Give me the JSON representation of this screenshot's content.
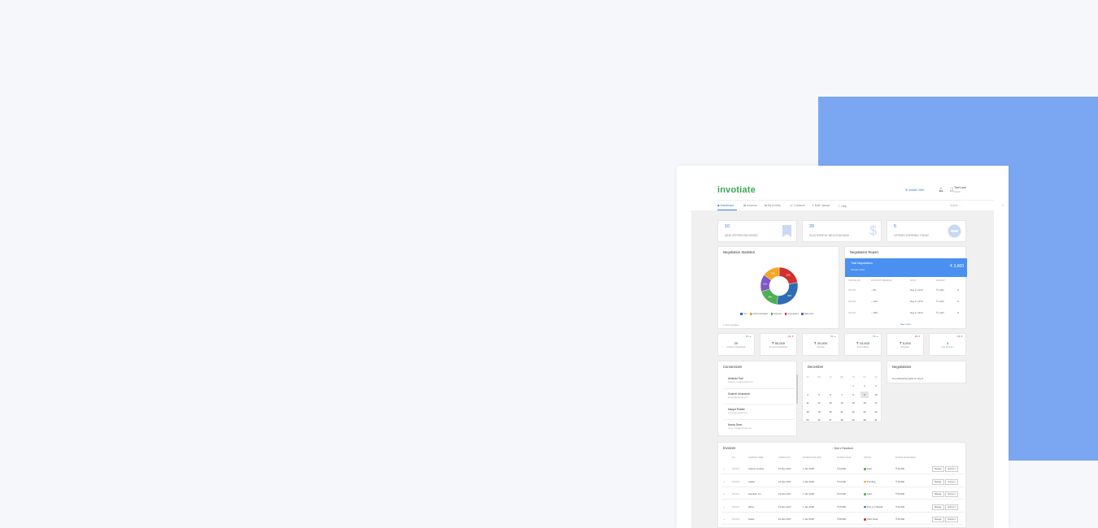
{
  "app": {
    "logo": "invotiate",
    "initiate_offer": "⊕ Initiate Offer",
    "user_name": "Tom Lose",
    "user_role": "Admin"
  },
  "nav": {
    "items": [
      "◆ Dashboard",
      "▤ Invoices",
      "⇆ My Activity",
      "☏ Contacts",
      "⇪ Bulk Upload",
      "ⓘ Help"
    ],
    "search_placeholder": "Search ..."
  },
  "stats": [
    {
      "value": "10",
      "label": "NEW OFFERS RECEIVED",
      "icon": "bookmark-icon"
    },
    {
      "value": "20",
      "label": "SUCCESSFUL NEGOTIATIONS",
      "icon": "dollar-icon"
    },
    {
      "value": "5",
      "label": "OFFERS EXPIRING TODAY",
      "icon": "minus-circle-icon"
    }
  ],
  "negotiation_statistics": {
    "title": "Negotiation Statistics",
    "legend": [
      "Live",
      "Acknowledged",
      "Expired",
      "Negotiated",
      "Rejected"
    ],
    "updated": "Just updated",
    "colors": [
      "#2e6db4",
      "#f5a623",
      "#4caf50",
      "#d32f2f",
      "#7e57c2"
    ],
    "chart_data": {
      "type": "pie",
      "series": [
        {
          "name": "Live",
          "value": 30
        },
        {
          "name": "Acknowledged",
          "value": 15
        },
        {
          "name": "Expired",
          "value": 18
        },
        {
          "name": "Negotiated",
          "value": 22
        },
        {
          "name": "Rejected",
          "value": 15
        }
      ],
      "segment_labels": [
        "30%",
        "15%",
        "18%",
        "22%",
        "15%"
      ]
    }
  },
  "negotiation_report": {
    "title": "Negotiation Report",
    "banner_title": "Total Negotiations",
    "banner_sub": "October 2018",
    "banner_amount": "₹ 3,000",
    "headers": [
      "INVOICE NO.",
      "DISCOUNT PREMIUM",
      "DATE",
      "AMOUNT"
    ],
    "rows": [
      [
        "001001",
        "~ 8%",
        "May 6, 2019",
        "₹ 1,000"
      ],
      [
        "001001",
        "~ 12%",
        "May 6, 2019",
        "₹ 1,000"
      ],
      [
        "001001",
        "~ 18%",
        "May 6, 2019",
        "₹ 1,000"
      ]
    ],
    "see_more": "See more"
  },
  "mini_stats": [
    {
      "change": "8% ▲",
      "value": "20",
      "label": "Invoices Negotiated",
      "up": true
    },
    {
      "change": "-3% ▼",
      "value": "₹ 50,000",
      "label": "Amount Negotiated",
      "up": false
    },
    {
      "change": "6% ▲",
      "value": "₹ 20,000",
      "label": "Savings",
      "up": true
    },
    {
      "change": "5% ▲",
      "value": "₹ 10,000",
      "label": "Receivables",
      "up": true
    },
    {
      "change": "-2% ▼",
      "value": "₹ 5,000",
      "label": "Payables",
      "up": false
    },
    {
      "change": "-1% ▼",
      "value": "3",
      "label": "Live Partners",
      "up": false
    }
  ],
  "connections": {
    "title": "Connections",
    "items": [
      {
        "name": "Amanda Suci",
        "email": "amanda_suci@example.com"
      },
      {
        "name": "Scarlett Johansson",
        "email": "scarlett@example.com"
      },
      {
        "name": "Margot Robbie",
        "email": "margot@example.com"
      },
      {
        "name": "Nancy Drew",
        "email": "nancy_drew@example.com"
      }
    ]
  },
  "calendar": {
    "month": "December",
    "dow": [
      "SU",
      "MO",
      "TU",
      "WE",
      "TH",
      "FR",
      "SA"
    ],
    "first_weekday": 4,
    "days": 31,
    "selected": 9
  },
  "negotiations_panel": {
    "title": "Negotiations",
    "text": "No outstanding tasks on July 8"
  },
  "invoices": {
    "title": "Invoices",
    "filter": "↑ Sent  ▾ Received",
    "headers": [
      "NO.",
      "COMPANY NAME",
      "OFFER DATE",
      "PAYMENT DUE DATE",
      "INVOICE VALUE",
      "STATUS",
      "INVOICE AFTER NEGO.",
      ""
    ],
    "manage_label": "Manage",
    "actions_label": "Actions ▾",
    "rows": [
      {
        "no": "001001",
        "company": "Carbon Limited",
        "offer": "19 Dec 2017",
        "due": "1 Jan 2018",
        "value": "₹ 23,000",
        "status": "Paid",
        "status_color": "#4caf50",
        "after": "₹ 20,000"
      },
      {
        "no": "001001",
        "company": "Adobe",
        "offer": "19 Dec 2017",
        "due": "1 Jan 2018",
        "value": "₹ 24,000",
        "status": "Pending",
        "status_color": "#f5a623",
        "after": "₹ 20,000"
      },
      {
        "no": "001001",
        "company": "Hamilton Co.",
        "offer": "19 Dec 2017",
        "due": "1 Jan 2018",
        "value": "₹ 23,000",
        "status": "Paid",
        "status_color": "#4caf50",
        "after": "₹ 20,000"
      },
      {
        "no": "001001",
        "company": "Wipro",
        "offer": "19 Dec 2017",
        "due": "1 Jan 2018",
        "value": "₹ 25,000",
        "status": "Due in 2 Weeks",
        "status_color": "#2e6db4",
        "after": "₹ 21,000"
      },
      {
        "no": "001001",
        "company": "Swiss",
        "offer": "19 Dec 2017",
        "due": "1 Jan 2018",
        "value": "₹ 28,000",
        "status": "Paid Today",
        "status_color": "#d32f2f",
        "after": "₹ 20,000"
      }
    ]
  }
}
